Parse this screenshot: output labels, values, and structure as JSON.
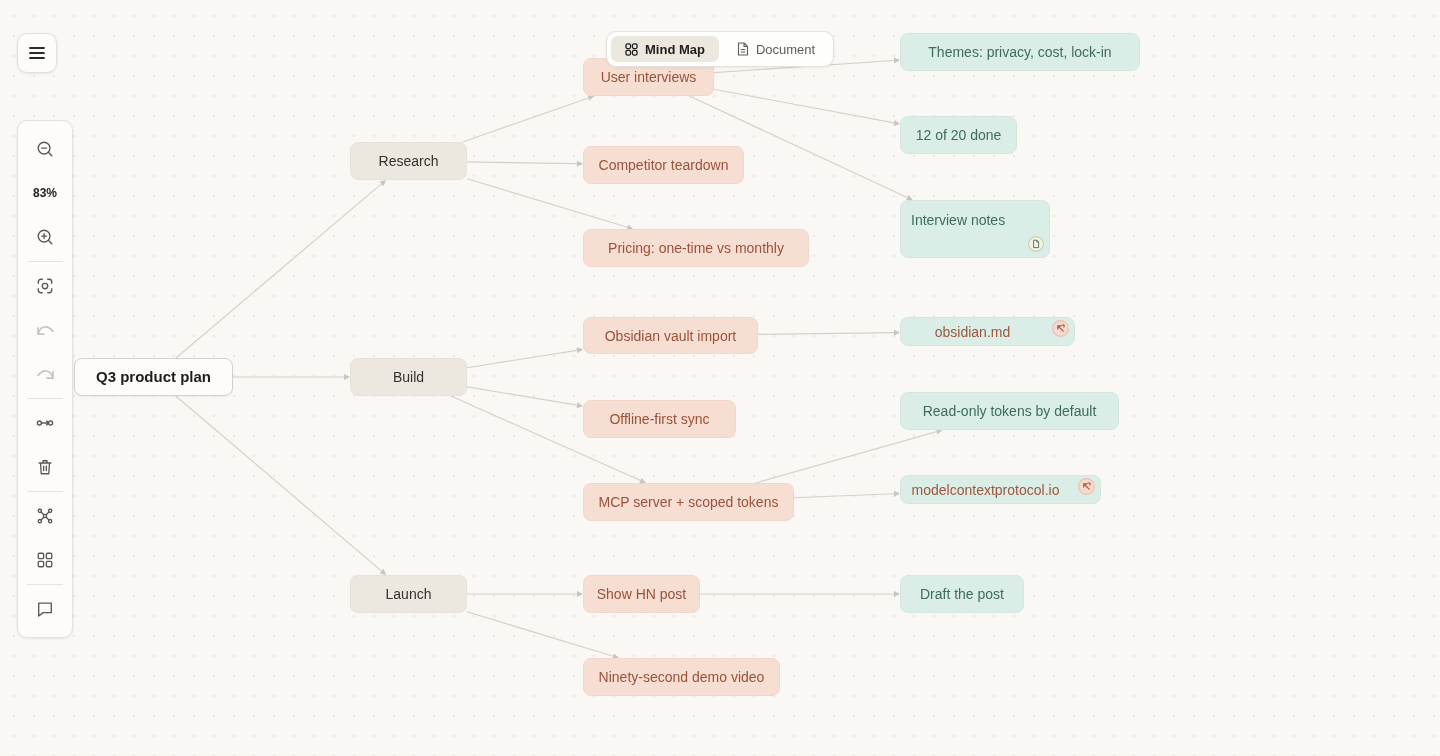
{
  "view_tabs": [
    {
      "label": "Mind Map",
      "kind": "mindmap",
      "selected": true
    },
    {
      "label": "Document",
      "kind": "document",
      "selected": false
    }
  ],
  "toolbar": {
    "groups": [
      [
        {
          "kind": "zoom_out",
          "disabled": false
        },
        {
          "kind": "zoom_level",
          "label": "83%",
          "disabled": false
        },
        {
          "kind": "zoom_in",
          "disabled": false
        }
      ],
      [
        {
          "kind": "fit",
          "disabled": false
        },
        {
          "kind": "undo",
          "disabled": true
        },
        {
          "kind": "redo",
          "disabled": true
        }
      ],
      [
        {
          "kind": "connect",
          "disabled": false
        },
        {
          "kind": "delete",
          "disabled": false
        }
      ],
      [
        {
          "kind": "network",
          "disabled": false
        },
        {
          "kind": "grid",
          "disabled": false
        }
      ],
      [
        {
          "kind": "comment",
          "disabled": false
        }
      ]
    ]
  },
  "mind_map": {
    "root": {
      "label": "Q3 product plan",
      "children": [
        {
          "label": "Research",
          "children": [
            {
              "label": "User interviews",
              "children": [
                {
                  "label": "Themes: privacy, cost, lock-in",
                  "kind": "note"
                },
                {
                  "label": "12 of 20 done",
                  "kind": "note"
                },
                {
                  "label": "Interview notes",
                  "kind": "document"
                }
              ]
            },
            {
              "label": "Competitor teardown"
            },
            {
              "label": "Pricing: one-time vs monthly"
            }
          ]
        },
        {
          "label": "Build",
          "children": [
            {
              "label": "Obsidian vault import",
              "children": [
                {
                  "label": "obsidian.md",
                  "kind": "link"
                }
              ]
            },
            {
              "label": "Offline-first sync"
            },
            {
              "label": "MCP server + scoped tokens",
              "children": [
                {
                  "label": "Read-only tokens by default",
                  "kind": "note"
                },
                {
                  "label": "modelcontextprotocol.io",
                  "kind": "link"
                }
              ]
            }
          ]
        },
        {
          "label": "Launch",
          "children": [
            {
              "label": "Show HN post",
              "children": [
                {
                  "label": "Draft the post",
                  "kind": "note"
                }
              ]
            },
            {
              "label": "Ninety-second demo video"
            }
          ]
        }
      ]
    }
  }
}
